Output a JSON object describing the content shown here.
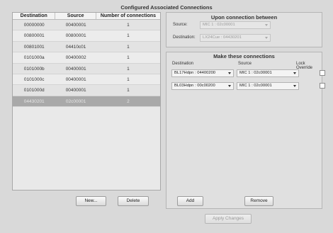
{
  "window": {
    "title": "Configured Associated Connections"
  },
  "table": {
    "headers": [
      "Destination",
      "Source",
      "Number of connections"
    ],
    "rows": [
      [
        "00000000",
        "00400001",
        "1"
      ],
      [
        "00800001",
        "00800001",
        "1"
      ],
      [
        "00801001",
        "04410c01",
        "1"
      ],
      [
        "0101000a",
        "00400002",
        "1"
      ],
      [
        "0101000b",
        "00400001",
        "1"
      ],
      [
        "0101000c",
        "00400001",
        "1"
      ],
      [
        "0101000d",
        "00400001",
        "1"
      ],
      [
        "04430201",
        "02c00001",
        "2"
      ]
    ]
  },
  "buttons": {
    "new": "New...",
    "delete": "Delete",
    "add": "Add",
    "remove": "Remove",
    "apply": "Apply Changes"
  },
  "upon": {
    "title": "Upon connection between",
    "source_label": "Source:",
    "source_value": "MIC 1 : 02c00001",
    "destination_label": "Destination:",
    "destination_value": "LX24Cue : 04430201"
  },
  "make": {
    "title": "Make these connections",
    "col_destination": "Destination",
    "col_source": "Source",
    "col_lock": "Lock Override",
    "rows": [
      {
        "destination": "BL17Hdpn : 04400200",
        "source": "MIC 1 : 02c00001"
      },
      {
        "destination": "BL03Hdpn : 00c00200",
        "source": "MIC 1 : 02c00001"
      }
    ]
  }
}
